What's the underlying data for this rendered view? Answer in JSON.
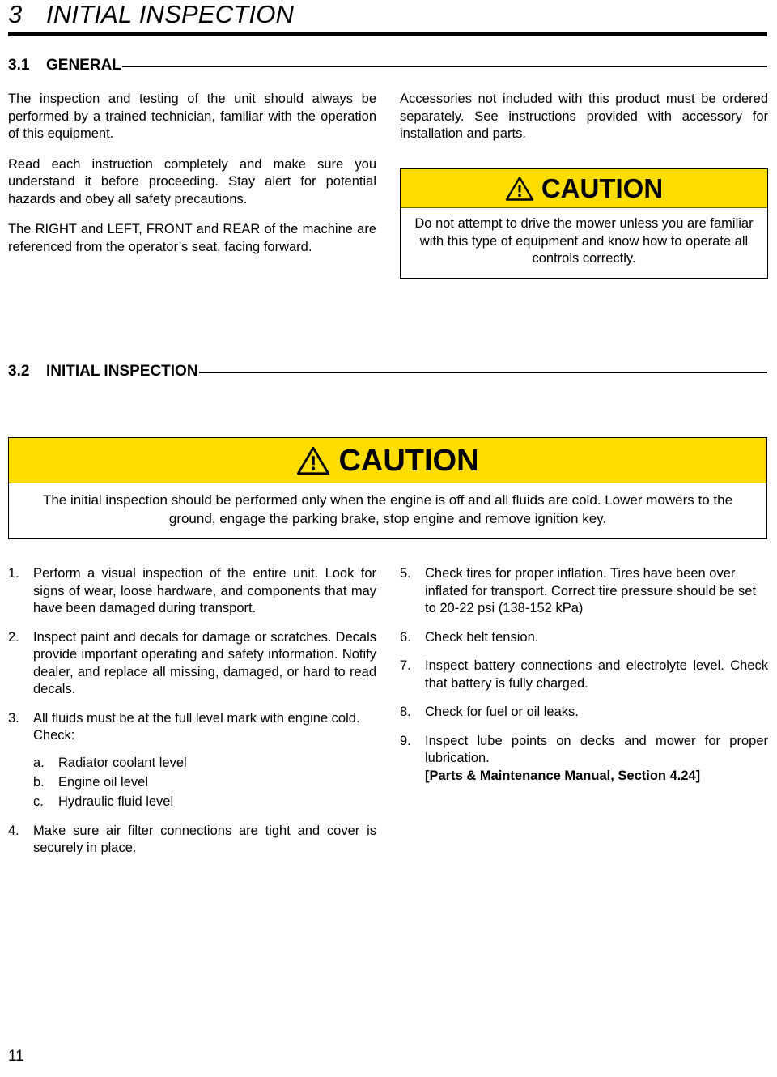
{
  "chapter": {
    "number": "3",
    "title": "INITIAL INSPECTION"
  },
  "sections": {
    "general": {
      "number": "3.1",
      "label": "GENERAL"
    },
    "initial_inspection": {
      "number": "3.2",
      "label": "INITIAL INSPECTION"
    }
  },
  "general": {
    "left_paragraphs": [
      "The inspection and testing of the unit should always be performed by a trained technician, familiar with the operation of this equipment.",
      "Read each instruction completely and make sure you understand it before proceeding. Stay alert for potential hazards and obey all safety precautions.",
      "The RIGHT and LEFT, FRONT and REAR of the machine are referenced from the operator’s seat, facing forward."
    ],
    "right_paragraphs": [
      "Accessories not included with this product must be ordered separately. See instructions provided with accessory for installation and parts."
    ]
  },
  "caution_general": {
    "icon": "warning-triangle-icon",
    "word": "CAUTION",
    "text": "Do not attempt to drive the mower unless you are familiar with this type of equipment and know how to operate all controls correctly."
  },
  "caution_inspection": {
    "icon": "warning-triangle-icon",
    "word": "CAUTION",
    "text": "The initial inspection should be performed only when the engine is off and all fluids are cold. Lower mowers to the ground, engage the parking brake, stop engine and remove ignition key."
  },
  "inspection_list_left": [
    {
      "marker": "1.",
      "text": "Perform a visual inspection of the entire unit. Look for signs of wear, loose hardware, and components that may have been damaged during transport."
    },
    {
      "marker": "2.",
      "text": "Inspect paint and decals for damage or scratches. Decals provide important operating and safety information. Notify dealer, and replace all missing, damaged, or hard to read decals."
    },
    {
      "marker": "3.",
      "text": "All fluids must be at the full level mark with engine cold."
    },
    {
      "marker": "4.",
      "text": "Make sure air filter connections are tight and cover is securely in place."
    }
  ],
  "check_label": "Check:",
  "check_sub_items": [
    {
      "marker": "a.",
      "text": "Radiator coolant level"
    },
    {
      "marker": "b.",
      "text": "Engine oil level"
    },
    {
      "marker": "c.",
      "text": "Hydraulic fluid level"
    }
  ],
  "inspection_list_right": [
    {
      "marker": "5.",
      "text": "Check tires for proper inflation. Tires have been over inflated for transport. Correct tire pressure should be set to 20-22 psi (138-152 kPa)"
    },
    {
      "marker": "6.",
      "text": "Check belt tension."
    },
    {
      "marker": "7.",
      "text": "Inspect battery connections and electrolyte level. Check that battery is fully charged."
    },
    {
      "marker": "8.",
      "text": "Check for fuel or oil leaks."
    },
    {
      "marker": "9.",
      "text": "Inspect lube points on decks and mower for proper lubrication."
    }
  ],
  "reference_note": "[Parts & Maintenance Manual, Section 4.24]",
  "page_number": "11",
  "colors": {
    "caution_yellow": "#FFDD00",
    "text": "#000000",
    "background": "#FFFFFF"
  }
}
